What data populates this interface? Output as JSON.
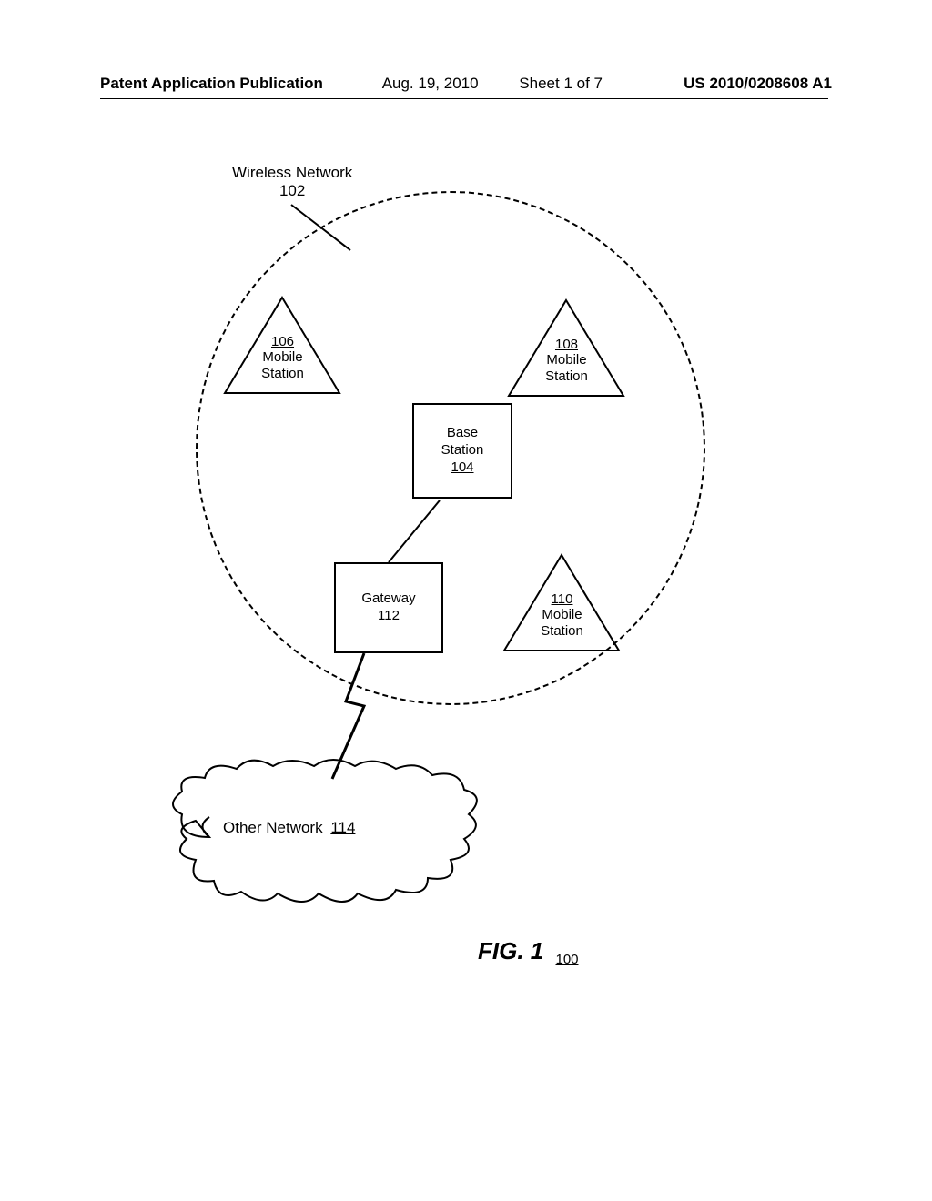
{
  "header": {
    "pubType": "Patent Application Publication",
    "date": "Aug. 19, 2010",
    "sheet": "Sheet 1 of 7",
    "pubNum": "US 2010/0208608 A1"
  },
  "diagram": {
    "networkLabel": "Wireless Network",
    "networkRef": "102",
    "ms106": {
      "ref": "106",
      "label": "Mobile\nStation"
    },
    "ms108": {
      "ref": "108",
      "label": "Mobile\nStation"
    },
    "ms110": {
      "ref": "110",
      "label": "Mobile\nStation"
    },
    "base": {
      "label": "Base\nStation",
      "ref": "104"
    },
    "gateway": {
      "label": "Gateway",
      "ref": "112"
    },
    "otherNet": {
      "label": "Other Network",
      "ref": "114"
    }
  },
  "figure": {
    "label": "FIG. 1",
    "ref": "100"
  }
}
